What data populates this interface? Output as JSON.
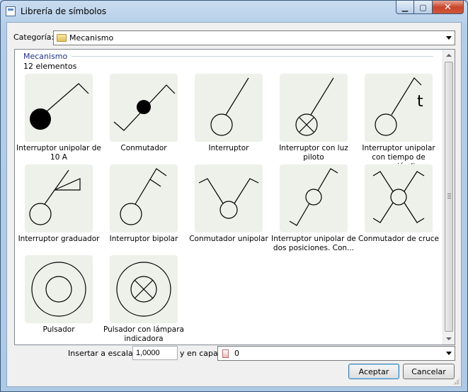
{
  "window": {
    "title": "Librería de símbolos",
    "minimize_icon": "minimize-icon",
    "maximize_icon": "maximize-icon",
    "close_icon": "close-icon"
  },
  "category": {
    "label": "Categoría:",
    "selected": "Mecanismo",
    "icon": "folder-icon"
  },
  "list": {
    "group_title": "Mecanismo",
    "group_count": "12 elementos",
    "items": [
      {
        "label": "Interruptor unipolar de 10 A",
        "symbol": "interruptor-unipolar-10a"
      },
      {
        "label": "Conmutador",
        "symbol": "conmutador"
      },
      {
        "label": "Interruptor",
        "symbol": "interruptor"
      },
      {
        "label": "Interruptor con luz piloto",
        "symbol": "interruptor-luz-piloto"
      },
      {
        "label": "Interruptor unipolar con tiempo de conexión li...",
        "symbol": "interruptor-temporizado"
      },
      {
        "label": "Interruptor graduador",
        "symbol": "interruptor-graduador"
      },
      {
        "label": "Interruptor bipolar",
        "symbol": "interruptor-bipolar"
      },
      {
        "label": "Conmutador unipolar",
        "symbol": "conmutador-unipolar"
      },
      {
        "label": "Interruptor unipolar de dos posiciones. Con...",
        "symbol": "interruptor-dos-posiciones"
      },
      {
        "label": "Conmutador de cruce",
        "symbol": "conmutador-cruce"
      },
      {
        "label": "Pulsador",
        "symbol": "pulsador"
      },
      {
        "label": "Pulsador con lámpara indicadora",
        "symbol": "pulsador-lampara"
      }
    ]
  },
  "scale": {
    "label": "Insertar a escala:",
    "value": "1,0000"
  },
  "layer": {
    "label": "y en capa:",
    "selected": "0",
    "icon": "layer-icon"
  },
  "buttons": {
    "ok": "Aceptar",
    "cancel": "Cancelar"
  }
}
